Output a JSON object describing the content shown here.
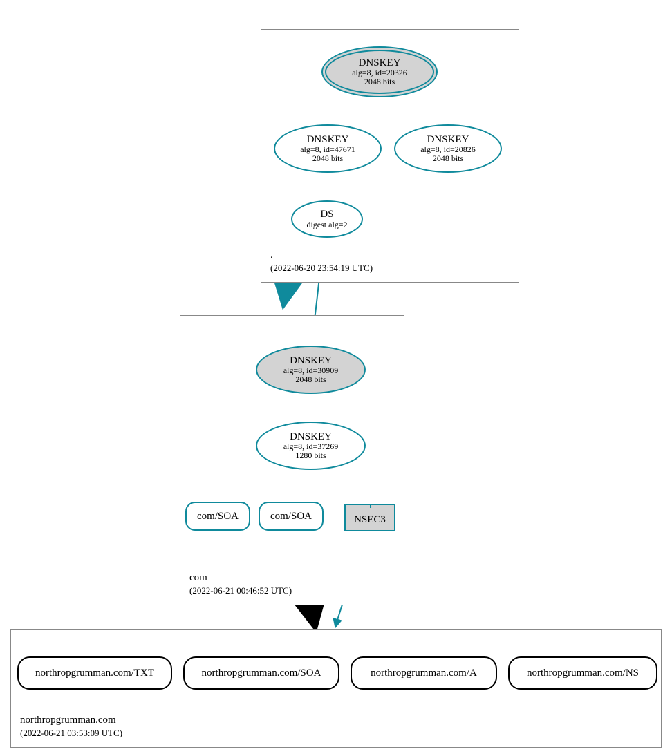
{
  "zones": {
    "root": {
      "name": ".",
      "timestamp": "(2022-06-20 23:54:19 UTC)"
    },
    "com": {
      "name": "com",
      "timestamp": "(2022-06-21 00:46:52 UTC)"
    },
    "ng": {
      "name": "northropgrumman.com",
      "timestamp": "(2022-06-21 03:53:09 UTC)"
    }
  },
  "nodes": {
    "root_ksk": {
      "title": "DNSKEY",
      "sub1": "alg=8, id=20326",
      "sub2": "2048 bits"
    },
    "root_zsk1": {
      "title": "DNSKEY",
      "sub1": "alg=8, id=47671",
      "sub2": "2048 bits"
    },
    "root_zsk2": {
      "title": "DNSKEY",
      "sub1": "alg=8, id=20826",
      "sub2": "2048 bits"
    },
    "root_ds": {
      "title": "DS",
      "sub1": "digest alg=2"
    },
    "com_ksk": {
      "title": "DNSKEY",
      "sub1": "alg=8, id=30909",
      "sub2": "2048 bits"
    },
    "com_zsk": {
      "title": "DNSKEY",
      "sub1": "alg=8, id=37269",
      "sub2": "1280 bits"
    },
    "com_soa1": {
      "label": "com/SOA"
    },
    "com_soa2": {
      "label": "com/SOA"
    },
    "com_nsec3": {
      "label": "NSEC3"
    },
    "ng_txt": {
      "label": "northropgrumman.com/TXT"
    },
    "ng_soa": {
      "label": "northropgrumman.com/SOA"
    },
    "ng_a": {
      "label": "northropgrumman.com/A"
    },
    "ng_ns": {
      "label": "northropgrumman.com/NS"
    }
  },
  "colors": {
    "teal": "#0f8a9c",
    "grey_fill": "#d3d3d3"
  }
}
